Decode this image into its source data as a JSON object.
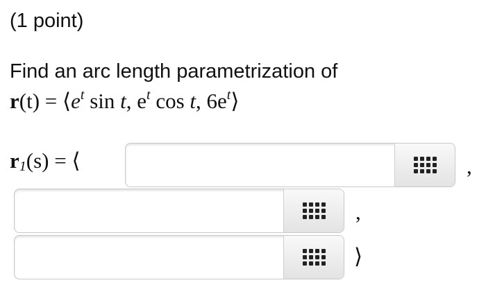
{
  "header": {
    "points": "(1 point)"
  },
  "problem": {
    "prompt": "Find an arc length parametrization of",
    "equation": {
      "lhs_bold": "r",
      "lhs_arg": "(t) = ⟨",
      "part1": "e",
      "sup_t1": "t",
      "part2": " sin ",
      "part2_var": "t",
      "part3": ", e",
      "sup_t2": "t",
      "part4": " cos ",
      "part4_var": "t",
      "part5": ", 6e",
      "sup_t3": "t",
      "close": "⟩"
    }
  },
  "answer": {
    "lhs_bold": "r",
    "lhs_sub": "1",
    "lhs_rest": "(s) = ⟨",
    "fields": [
      {
        "value": "",
        "placeholder": ""
      },
      {
        "value": "",
        "placeholder": ""
      },
      {
        "value": "",
        "placeholder": ""
      }
    ],
    "button_icon": "keypad-grid-icon",
    "separators": [
      ",",
      ",",
      "⟩"
    ]
  }
}
